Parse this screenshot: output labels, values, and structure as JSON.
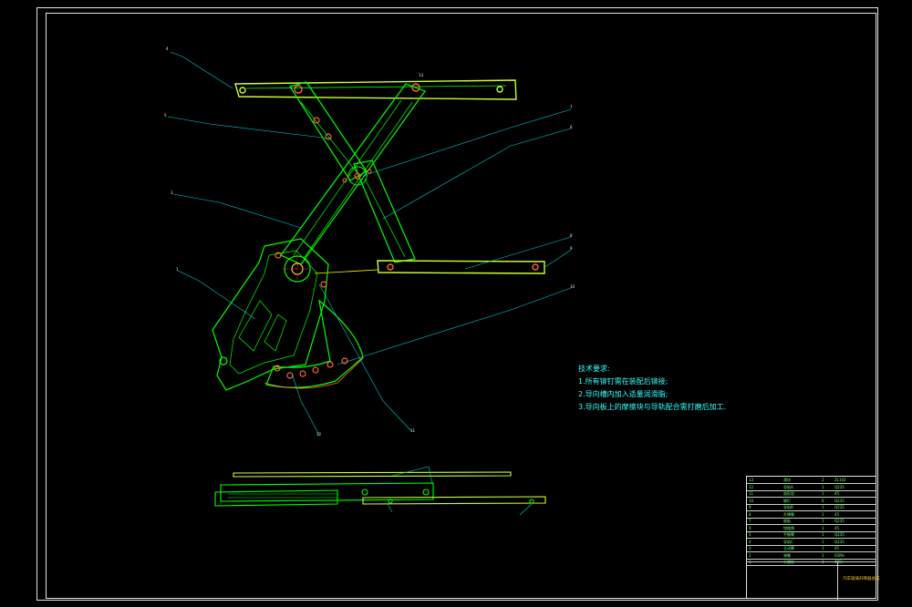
{
  "notes": {
    "title": "技术要求:",
    "items": [
      "1.所有铆钉需在装配后铆接;",
      "2.导向槽内加入适量润滑脂;",
      "3.导向板上的摩擦块与导轨配合需打磨后加工."
    ]
  },
  "callouts": [
    "4",
    "5",
    "3",
    "1",
    "7",
    "6",
    "8",
    "9",
    "10",
    "11",
    "12",
    "13"
  ],
  "title_block": {
    "drawing_name": "汽车玻璃升降器总成",
    "rows": [
      {
        "no": "13",
        "name": "滑块",
        "qty": "2",
        "mat": "ZL102"
      },
      {
        "no": "12",
        "name": "导轨A",
        "qty": "1",
        "mat": "Q235"
      },
      {
        "no": "11",
        "name": "扇形齿",
        "qty": "1",
        "mat": "45"
      },
      {
        "no": "10",
        "name": "铆钉",
        "qty": "6",
        "mat": "Q235"
      },
      {
        "no": "9",
        "name": "导轨B",
        "qty": "1",
        "mat": "Q235"
      },
      {
        "no": "8",
        "name": "升降臂",
        "qty": "1",
        "mat": "45"
      },
      {
        "no": "7",
        "name": "底板",
        "qty": "1",
        "mat": "Q235"
      },
      {
        "no": "6",
        "name": "铰链销",
        "qty": "1",
        "mat": "45"
      },
      {
        "no": "5",
        "name": "平衡臂",
        "qty": "1",
        "mat": "Q235"
      },
      {
        "no": "4",
        "name": "导轨C",
        "qty": "1",
        "mat": "Q235"
      },
      {
        "no": "3",
        "name": "主动臂",
        "qty": "1",
        "mat": "45"
      },
      {
        "no": "2",
        "name": "弹簧",
        "qty": "1",
        "mat": "65Mn"
      },
      {
        "no": "1",
        "name": "小齿轮",
        "qty": "1",
        "mat": "40Cr"
      }
    ]
  },
  "colors": {
    "part": "#00ff00",
    "highlight": "#ccff33",
    "leader": "#00cccc",
    "centerline": "#ff3333",
    "dimension": "#ffff00",
    "frame": "#e6e6e6"
  }
}
